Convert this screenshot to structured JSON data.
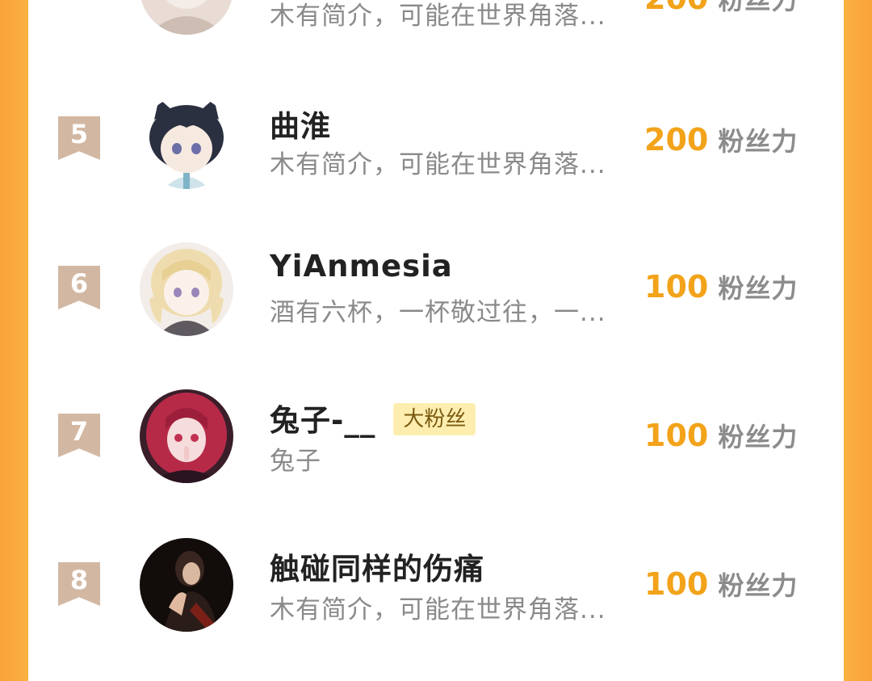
{
  "theme": {
    "accent": "#f2a31a",
    "rank_badge": "#d2b8a3",
    "badge_bg": "#fdeeb0"
  },
  "ranking": [
    {
      "rank": "",
      "name": "",
      "bio": "木有简介，可能在世界角落...",
      "score": "200",
      "unit": "粉丝力",
      "avatar_icon": "anime-avatar"
    },
    {
      "rank": "5",
      "name": "曲淮",
      "bio": "木有简介，可能在世界角落...",
      "score": "200",
      "unit": "粉丝力",
      "avatar_icon": "anime-boy-cat-ears-avatar"
    },
    {
      "rank": "6",
      "name": "YiAnmesia",
      "bio": "酒有六杯，一杯敬过往，一...",
      "score": "100",
      "unit": "粉丝力",
      "avatar_icon": "anime-blonde-girl-avatar"
    },
    {
      "rank": "7",
      "name": "兔子-__",
      "badge": "大粉丝",
      "bio": "兔子",
      "score": "100",
      "unit": "粉丝力",
      "avatar_icon": "anime-red-hair-girl-avatar"
    },
    {
      "rank": "8",
      "name": "触碰同样的伤痛",
      "bio": "木有简介，可能在世界角落...",
      "score": "100",
      "unit": "粉丝力",
      "avatar_icon": "dark-portrait-avatar"
    }
  ]
}
